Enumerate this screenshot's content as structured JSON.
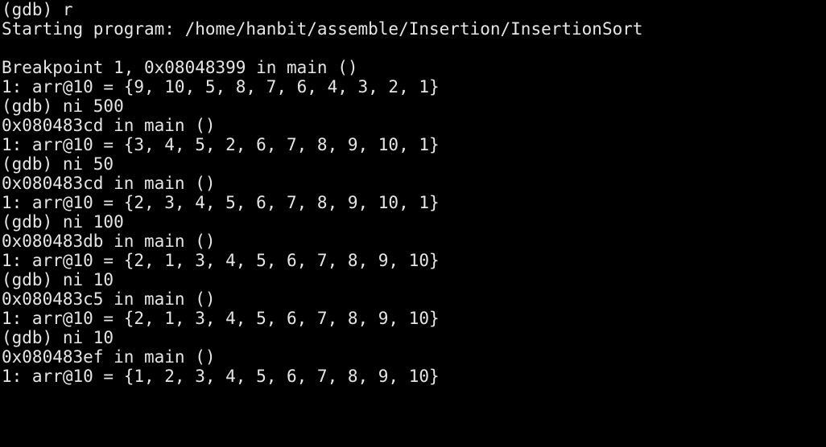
{
  "terminal": {
    "colors": {
      "background": "#000000",
      "foreground": "#e6e6e6"
    },
    "lines": [
      "(gdb) r",
      "Starting program: /home/hanbit/assemble/Insertion/InsertionSort",
      "",
      "Breakpoint 1, 0x08048399 in main ()",
      "1: arr@10 = {9, 10, 5, 8, 7, 6, 4, 3, 2, 1}",
      "(gdb) ni 500",
      "0x080483cd in main ()",
      "1: arr@10 = {3, 4, 5, 2, 6, 7, 8, 9, 10, 1}",
      "(gdb) ni 50",
      "0x080483cd in main ()",
      "1: arr@10 = {2, 3, 4, 5, 6, 7, 8, 9, 10, 1}",
      "(gdb) ni 100",
      "0x080483db in main ()",
      "1: arr@10 = {2, 1, 3, 4, 5, 6, 7, 8, 9, 10}",
      "(gdb) ni 10",
      "0x080483c5 in main ()",
      "1: arr@10 = {2, 1, 3, 4, 5, 6, 7, 8, 9, 10}",
      "(gdb) ni 10",
      "0x080483ef in main ()",
      "1: arr@10 = {1, 2, 3, 4, 5, 6, 7, 8, 9, 10}"
    ]
  }
}
